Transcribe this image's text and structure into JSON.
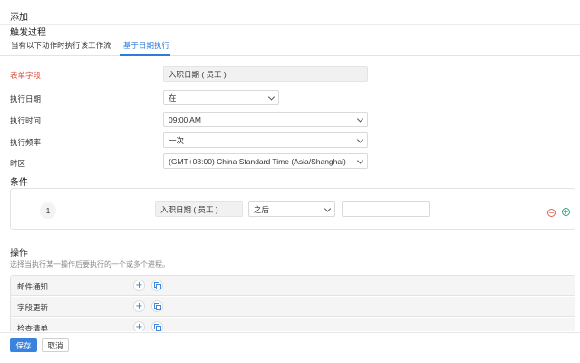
{
  "header": {
    "title": "添加",
    "section": "触发过程"
  },
  "tabs": [
    {
      "label": "当有以下动作时执行该工作流",
      "active": false
    },
    {
      "label": "基于日期执行",
      "active": true
    }
  ],
  "trigger_form": {
    "form_field": {
      "label": "表单字段",
      "value": "入职日期 ( 员工 )"
    },
    "exec_date": {
      "label": "执行日期",
      "value": "在"
    },
    "exec_time": {
      "label": "执行时间",
      "value": "09:00 AM"
    },
    "exec_frequency": {
      "label": "执行频率",
      "value": "一次"
    },
    "timezone": {
      "label": "时区",
      "value": "(GMT+08:00) China Standard Time (Asia/Shanghai)"
    }
  },
  "conditions": {
    "title": "条件",
    "rows": [
      {
        "index": "1",
        "field": "入职日期 ( 员工 )",
        "operator": "之后",
        "value": ""
      }
    ]
  },
  "actions": {
    "title": "操作",
    "hint": "选择当执行某一操作后要执行的一个或多个进程。",
    "items": [
      {
        "label": "邮件通知"
      },
      {
        "label": "字段更新"
      },
      {
        "label": "检查清单"
      }
    ]
  },
  "footer": {
    "save_label": "保存",
    "cancel_label": "取消"
  },
  "colors": {
    "accent": "#2f7bd9",
    "required": "#d94a3a",
    "primary_button": "#3a82e0"
  },
  "icons": {
    "add": "plus-circle-icon",
    "link": "link-icon",
    "remove": "minus-circle-icon",
    "dropdown": "chevron-down-icon"
  }
}
